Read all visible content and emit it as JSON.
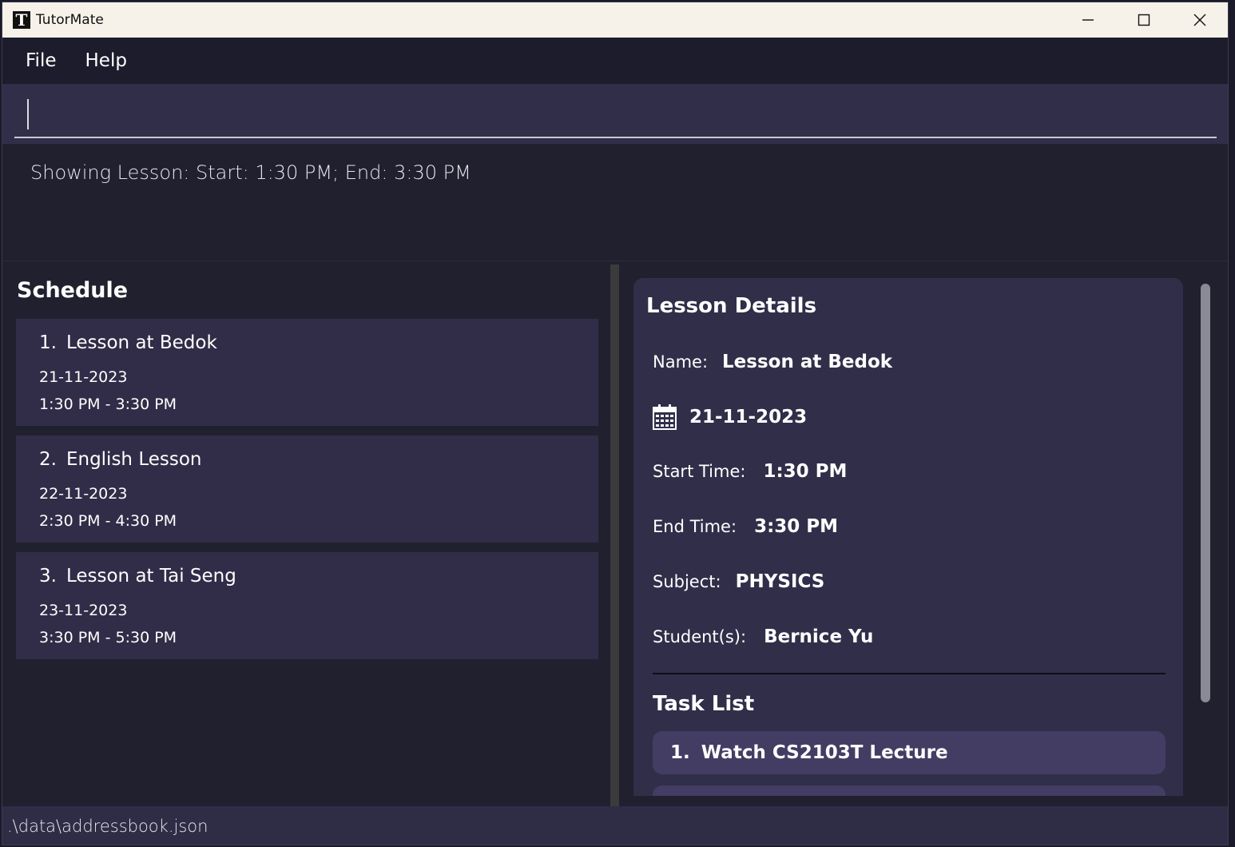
{
  "window": {
    "title": "TutorMate",
    "icon_letter": "T",
    "controls": [
      "minimize-icon",
      "maximize-icon",
      "close-icon"
    ]
  },
  "menu": {
    "file": "File",
    "help": "Help"
  },
  "command": {
    "value": "",
    "placeholder": ""
  },
  "result": {
    "text": "Showing Lesson: Start: 1:30 PM; End: 3:30 PM"
  },
  "schedule": {
    "title": "Schedule",
    "lessons": [
      {
        "index": "1.",
        "name": "Lesson at Bedok",
        "date": "21-11-2023",
        "time": "1:30 PM - 3:30 PM"
      },
      {
        "index": "2.",
        "name": "English Lesson",
        "date": "22-11-2023",
        "time": "2:30 PM - 4:30 PM"
      },
      {
        "index": "3.",
        "name": "Lesson at Tai Seng",
        "date": "23-11-2023",
        "time": "3:30 PM - 5:30 PM"
      }
    ]
  },
  "details": {
    "title": "Lesson Details",
    "name_label": "Name:",
    "name_value": "Lesson at Bedok",
    "date_icon": "calendar-icon",
    "date_value": "21-11-2023",
    "start_label": "Start Time:",
    "start_value": "1:30 PM",
    "end_label": "End Time:",
    "end_value": "3:30 PM",
    "subject_label": "Subject:",
    "subject_value": "PHYSICS",
    "students_label": "Student(s):",
    "students_value": "Bernice Yu",
    "task_title": "Task List",
    "tasks": [
      {
        "index": "1.",
        "text": "Watch CS2103T Lecture"
      }
    ]
  },
  "status": {
    "file_path": ".\\data\\addressbook.json"
  },
  "colors": {
    "background": "#21202f",
    "card": "#312d48",
    "accent_task": "#433d63",
    "titlebar": "#f6f2e9"
  }
}
